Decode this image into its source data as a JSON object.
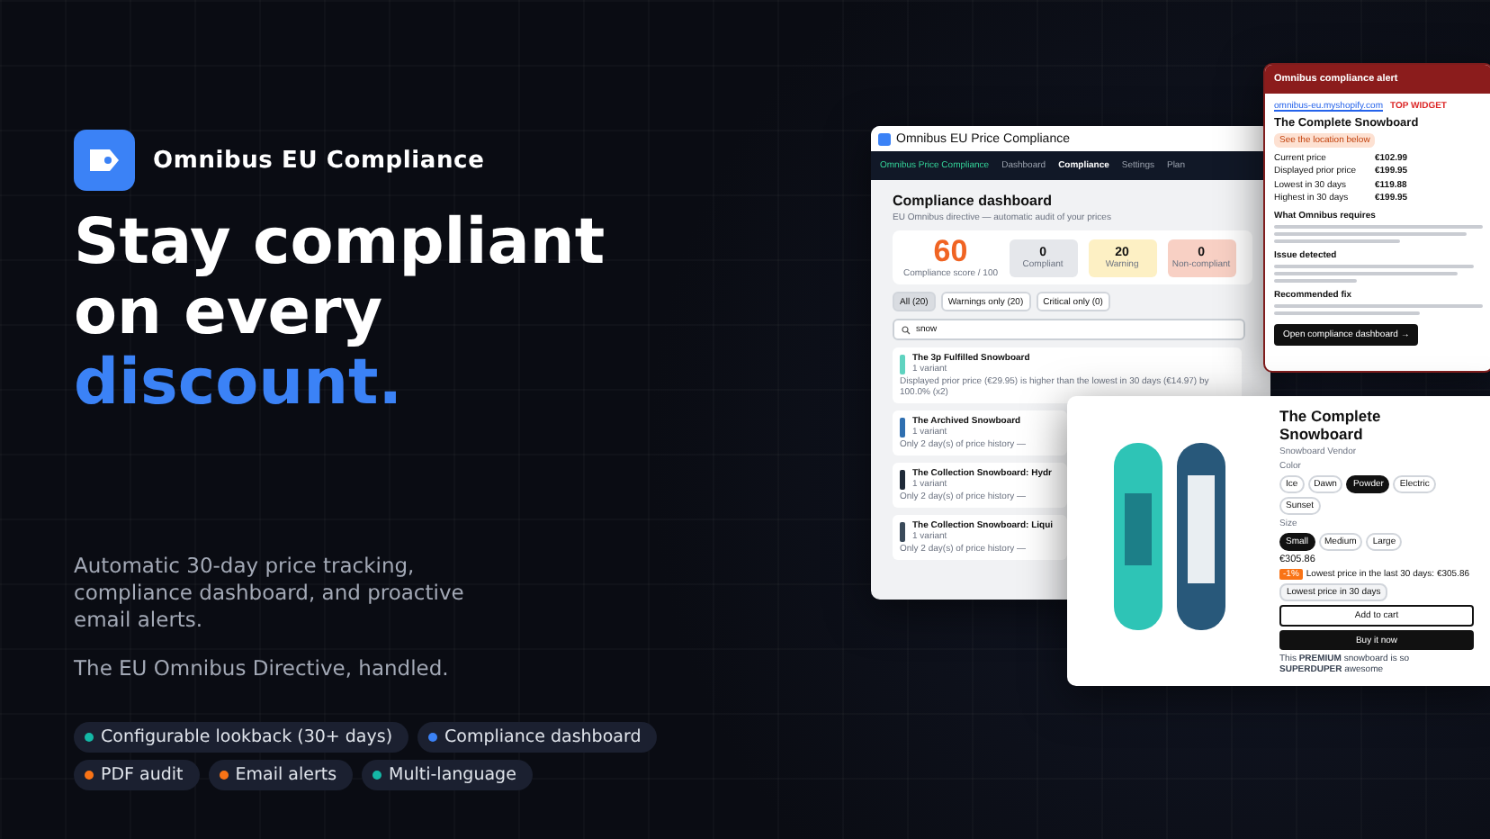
{
  "brand": {
    "name": "Omnibus EU Compliance"
  },
  "headline": {
    "lines": [
      "Stay compliant",
      "on every"
    ],
    "accent": "discount."
  },
  "description": "Automatic 30-day price tracking, compliance dashboard, and proactive email alerts.",
  "tagline": "The EU Omnibus Directive, handled.",
  "features": [
    {
      "label": "Configurable lookback (30+ days)",
      "color": "#14b8a6"
    },
    {
      "label": "Compliance dashboard",
      "color": "#3b82f6"
    },
    {
      "label": "PDF audit",
      "color": "#f97316"
    },
    {
      "label": "Email alerts",
      "color": "#f97316"
    },
    {
      "label": "Multi-language",
      "color": "#14b8a6"
    }
  ],
  "dashboard": {
    "window_title": "Omnibus EU Price Compliance",
    "nav_brand": "Omnibus Price Compliance",
    "nav": [
      {
        "label": "Dashboard",
        "selected": false
      },
      {
        "label": "Compliance",
        "selected": true
      },
      {
        "label": "Settings",
        "selected": false
      },
      {
        "label": "Plan",
        "selected": false
      }
    ],
    "title": "Compliance dashboard",
    "subtitle": "EU Omnibus directive — automatic audit of your prices",
    "score": "60",
    "score_label": "Compliance score / 100",
    "stats": [
      {
        "value": "0",
        "label": "Compliant",
        "color": "#e5e7eb"
      },
      {
        "value": "20",
        "label": "Warning",
        "color": "#fdf0c4"
      },
      {
        "value": "0",
        "label": "Non-compliant",
        "color": "#f8d0c4"
      }
    ],
    "filters": [
      {
        "label": "All (20)",
        "selected": true
      },
      {
        "label": "Warnings only (20)",
        "selected": false
      },
      {
        "label": "Critical only (0)",
        "selected": false
      }
    ],
    "search": {
      "value": "snow"
    },
    "products": [
      {
        "name": "The 3p Fulfilled Snowboard",
        "variants": "1 variant",
        "message": "Displayed prior price (€29.95) is higher than the lowest in 30 days (€14.97) by 100.0% (x2)",
        "color": "#5fd3c0"
      },
      {
        "name": "The Archived Snowboard",
        "variants": "1 variant",
        "message": "Only 2 day(s) of price history —",
        "color": "#2f6fb0"
      },
      {
        "name": "The Collection Snowboard: Hydr",
        "variants": "1 variant",
        "message": "Only 2 day(s) of price history —",
        "color": "#1f2a38"
      },
      {
        "name": "The Collection Snowboard: Liqui",
        "variants": "1 variant",
        "message": "Only 2 day(s) of price history —",
        "color": "#3a4a5a"
      }
    ]
  },
  "alert": {
    "header": "Omnibus compliance alert",
    "store": "omnibus-eu.myshopify.com",
    "tag": "TOP WIDGET",
    "product": "The Complete Snowboard",
    "badge": "See the location below",
    "rows": [
      {
        "label": "Current price",
        "value": "€102.99"
      },
      {
        "label": "Displayed prior price",
        "value": "€199.95"
      },
      {
        "label": "Lowest in 30 days",
        "value": "€119.88"
      },
      {
        "label": "Highest in 30 days",
        "value": "€199.95"
      }
    ],
    "sections": [
      {
        "heading": "What Omnibus requires"
      },
      {
        "heading": "Issue detected"
      },
      {
        "heading": "Recommended fix"
      }
    ],
    "button": "Open compliance dashboard →"
  },
  "product_page": {
    "title": "The Complete Snowboard",
    "vendor": "Snowboard Vendor",
    "options": [
      {
        "label": "Color",
        "values": [
          {
            "label": "Ice",
            "selected": false
          },
          {
            "label": "Dawn",
            "selected": false
          },
          {
            "label": "Powder",
            "selected": true
          },
          {
            "label": "Electric",
            "selected": false
          },
          {
            "label": "Sunset",
            "selected": false
          }
        ]
      },
      {
        "label": "Size",
        "values": [
          {
            "label": "Small",
            "selected": true
          },
          {
            "label": "Medium",
            "selected": false
          },
          {
            "label": "Large",
            "selected": false
          }
        ]
      }
    ],
    "price": "€305.86",
    "omnibus_tag": "-1%",
    "omnibus_note": "Lowest price in the last 30 days: €305.86",
    "omnibus_badge": "Lowest price in 30 days",
    "add_to_cart": "Add to cart",
    "buy_now": "Buy it now",
    "description": "This **PREMIUM** snowboard is so **SUPERDUPER** awesome"
  }
}
